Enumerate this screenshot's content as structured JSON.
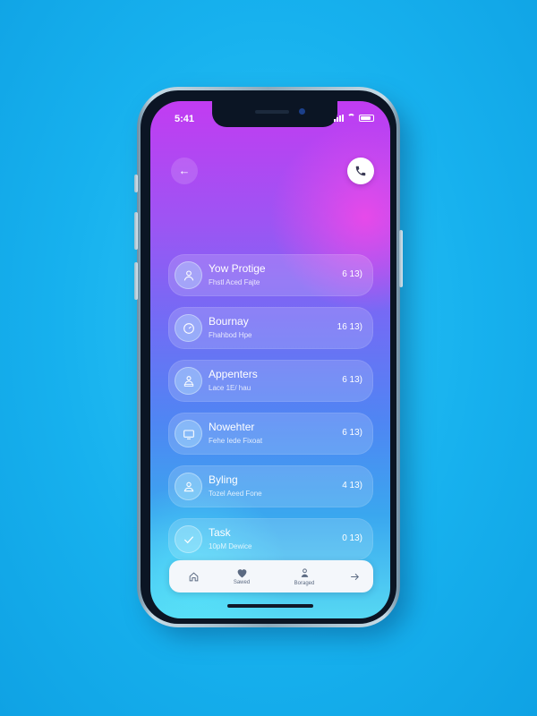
{
  "status_bar": {
    "time": "5:41"
  },
  "header": {
    "back_icon": "back-arrow-icon",
    "call_icon": "phone-icon"
  },
  "list": {
    "items": [
      {
        "title": "Yow Protige",
        "subtitle": "Fhstl Aced Fajte",
        "meta": "6 13)",
        "icon": "person-icon"
      },
      {
        "title": "Bournay",
        "subtitle": "Fhahbod Hpe",
        "meta": "16 13)",
        "icon": "gauge-icon"
      },
      {
        "title": "Appenters",
        "subtitle": "Lace 1E/ hau",
        "meta": "6 13)",
        "icon": "person-desk-icon"
      },
      {
        "title": "Nowehter",
        "subtitle": "Fehe Iede Fixoat",
        "meta": "6 13)",
        "icon": "monitor-icon"
      },
      {
        "title": "Byling",
        "subtitle": "Tozel Aeed Fone",
        "meta": "4 13)",
        "icon": "person-bell-icon"
      },
      {
        "title": "Task",
        "subtitle": "10pM Dewice",
        "meta": "0 13)",
        "icon": "check-icon"
      }
    ]
  },
  "tabbar": {
    "tabs": [
      {
        "label": "",
        "icon": "home-icon"
      },
      {
        "label": "Sawed",
        "icon": "heart-icon"
      },
      {
        "label": "Boraged",
        "icon": "person-badge-icon"
      },
      {
        "label": "",
        "icon": "arrow-right-icon"
      }
    ]
  },
  "colors": {
    "background": "#17b1ee",
    "screen_top": "#c23cf2",
    "screen_bottom": "#56d8f3",
    "tabbar": "#f4f7fb"
  }
}
